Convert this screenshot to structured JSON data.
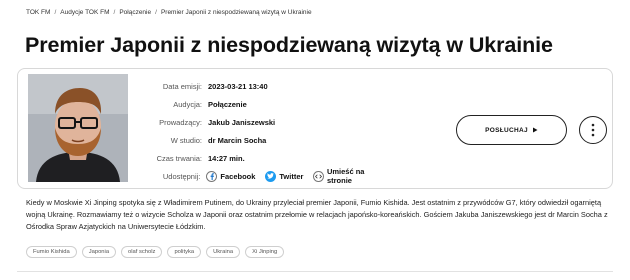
{
  "breadcrumb": {
    "items": [
      "TOK FM",
      "Audycje TOK FM",
      "Połączenie",
      "Premier Japonii z niespodziewaną wizytą w Ukrainie"
    ]
  },
  "page": {
    "title": "Premier Japonii z niespodziewaną wizytą w Ukrainie"
  },
  "meta": {
    "date_label": "Data emisji:",
    "date_value": "2023-03-21 13:40",
    "show_label": "Audycja:",
    "show_value": "Połączenie",
    "host_label": "Prowadzący:",
    "host_value": "Jakub Janiszewski",
    "studio_label": "W studio:",
    "studio_value": "dr Marcin Socha",
    "duration_label": "Czas trwania:",
    "duration_value": "14:27 min.",
    "share_label": "Udostępnij:",
    "share_facebook": "Facebook",
    "share_twitter": "Twitter",
    "share_embed": "Umieść na stronie"
  },
  "actions": {
    "listen_label": "POSŁUCHAJ"
  },
  "description": "Kiedy w Moskwie Xi Jinping spotyka się z Władimirem Putinem, do Ukrainy przyleciał premier Japonii, Fumio Kishida. Jest ostatnim z przywódców G7, który odwiedził ogarniętą wojną Ukrainę. Rozmawiamy też o wizycie Scholza w Japonii oraz ostatnim przełomie w relacjach japońsko-koreańskich. Gościem Jakuba Janiszewskiego jest dr Marcin Socha z Ośrodka Spraw Azjatyckich na Uniwersytecie Łódzkim.",
  "tags": [
    "Fumio Kishida",
    "Japonia",
    "olaf scholz",
    "polityka",
    "Ukraina",
    "Xi Jinping"
  ],
  "colors": {
    "accent": "#1a73c8",
    "border": "#d8d8d8"
  },
  "icons": {
    "facebook": "facebook-icon",
    "twitter": "twitter-icon",
    "embed": "embed-icon",
    "play": "play-icon",
    "more": "more-vertical-icon"
  }
}
